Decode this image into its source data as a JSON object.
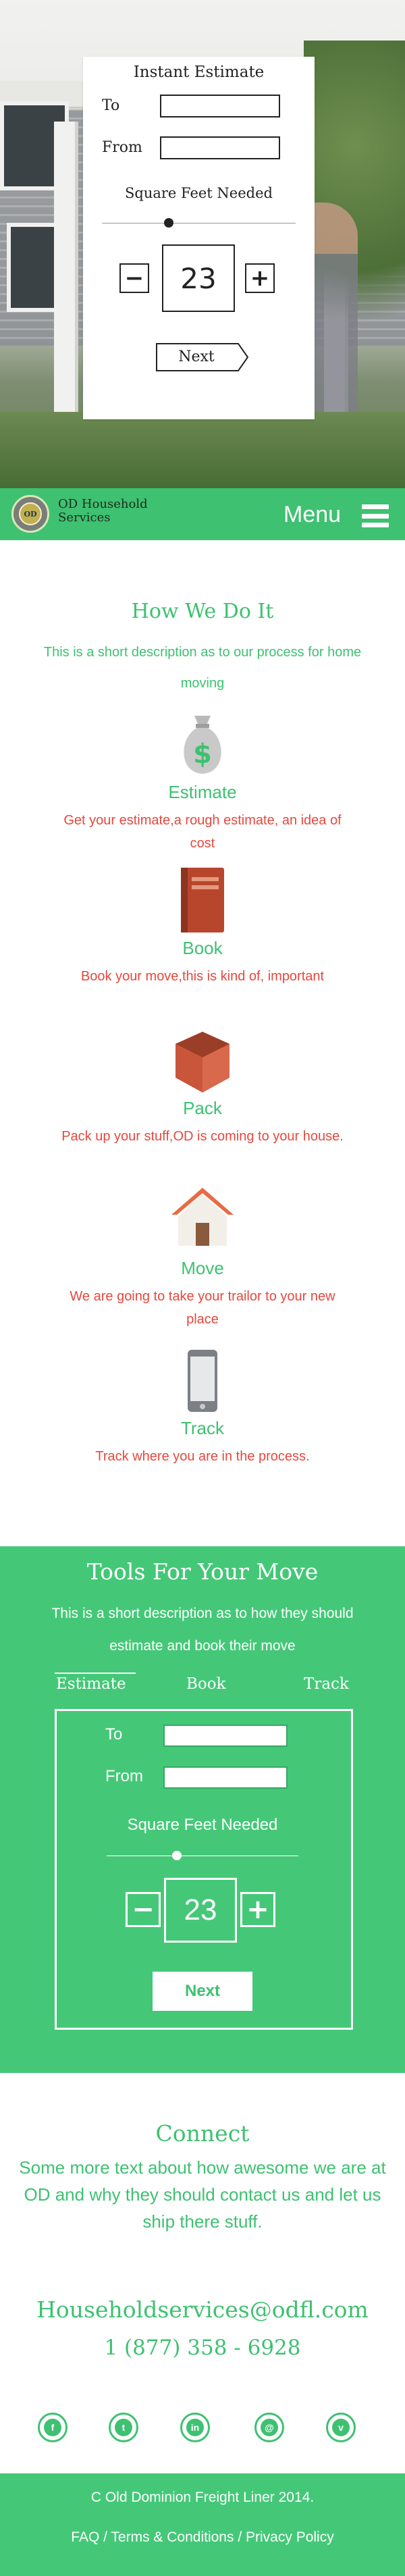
{
  "hero": {
    "card": {
      "title": "Instant Estimate",
      "to_label": "To",
      "from_label": "From",
      "to_value": "",
      "from_value": "",
      "sqft_label": "Square Feet Needed",
      "decrement": "−",
      "increment": "+",
      "value": "23",
      "next_label": "Next"
    }
  },
  "nav": {
    "logo_text": "OD",
    "brand_line1": "OD Household",
    "brand_line2": "Services",
    "menu_label": "Menu"
  },
  "how": {
    "title": "How We Do It",
    "description": "This is a short description as to our process for home moving",
    "steps": [
      {
        "icon": "money-bag-icon",
        "title": "Estimate",
        "description": "Get your estimate,a rough estimate, an idea of cost"
      },
      {
        "icon": "book-icon",
        "title": "Book",
        "description": "Book your move,this is kind of, important"
      },
      {
        "icon": "box-icon",
        "title": "Pack",
        "description": "Pack up your stuff,OD is coming to your house."
      },
      {
        "icon": "house-icon",
        "title": "Move",
        "description": "We are going to take your trailor to your new place"
      },
      {
        "icon": "phone-icon",
        "title": "Track",
        "description": "Track where you are in the process."
      }
    ]
  },
  "tools": {
    "title": "Tools For Your Move",
    "description": "This is a short description as to how they should estimate and book their move",
    "tabs": [
      "Estimate",
      "Book",
      "Track"
    ],
    "active_tab": "Estimate",
    "widget": {
      "to_label": "To",
      "from_label": "From",
      "to_value": "",
      "from_value": "",
      "sqft_label": "Square Feet Needed",
      "decrement": "−",
      "increment": "+",
      "value": "23",
      "next_label": "Next"
    }
  },
  "connect": {
    "title": "Connect",
    "text": "Some more text about how awesome we are at OD and why they should contact us and let us ship there stuff.",
    "email": "Householdservices@odfl.com",
    "phone": "1 (877) 358 - 6928",
    "social": [
      {
        "icon": "facebook-icon",
        "glyph": "f"
      },
      {
        "icon": "twitter-icon",
        "glyph": "t"
      },
      {
        "icon": "linkedin-icon",
        "glyph": "in"
      },
      {
        "icon": "instagram-icon",
        "glyph": "@"
      },
      {
        "icon": "vimeo-icon",
        "glyph": "v"
      }
    ]
  },
  "footer": {
    "copyright": "C Old Dominion Freight Liner 2014.",
    "links": [
      "FAQ",
      "Terms & Conditions",
      "Privacy Policy"
    ],
    "separator": " / "
  },
  "colors": {
    "brand_green": "#3ec171",
    "section_green": "#44c878",
    "accent_red": "#e8473c"
  }
}
